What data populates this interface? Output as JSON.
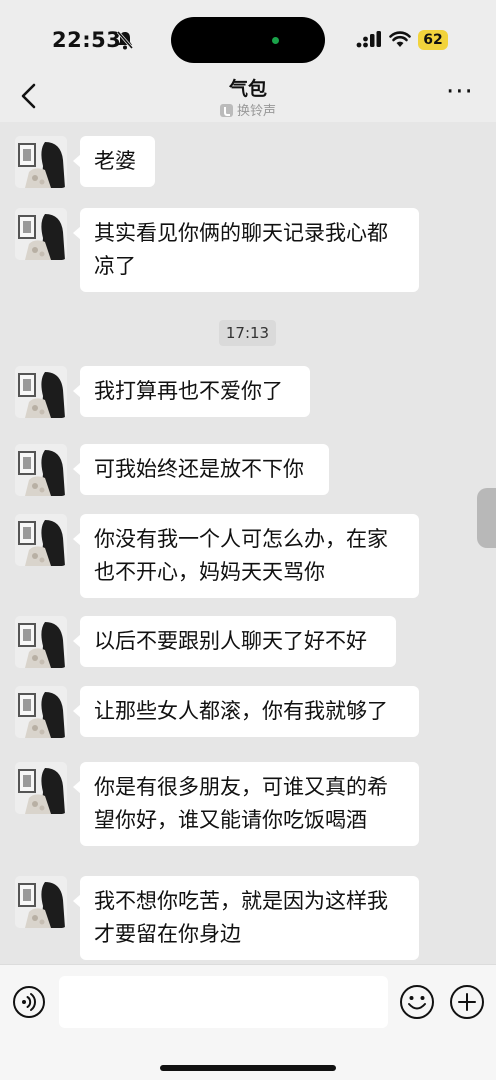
{
  "status_bar": {
    "time": "22:53",
    "battery": "62",
    "silent_icon": "bell-slash-icon",
    "signal_icon": "cellular-signal-icon",
    "wifi_icon": "wifi-icon",
    "battery_color": "#f2d33c"
  },
  "nav": {
    "title": "气包",
    "subtitle": "换铃声",
    "back_icon": "chevron-left-icon",
    "more_icon": "more-horizontal-icon"
  },
  "chat": {
    "timestamp": "17:13",
    "bubble_color": "#ffffff",
    "background_color": "#e6e6e6",
    "messages": [
      {
        "sender": "contact",
        "lines": [
          "老婆"
        ]
      },
      {
        "sender": "contact",
        "lines": [
          "其实看见你俩的聊天记录我心都",
          "凉了"
        ]
      },
      {
        "sender": "contact",
        "lines": [
          "我打算再也不爱你了"
        ]
      },
      {
        "sender": "contact",
        "lines": [
          "可我始终还是放不下你"
        ]
      },
      {
        "sender": "contact",
        "lines": [
          "你没有我一个人可怎么办，在家",
          "也不开心，妈妈天天骂你"
        ]
      },
      {
        "sender": "contact",
        "lines": [
          "以后不要跟别人聊天了好不好"
        ]
      },
      {
        "sender": "contact",
        "lines": [
          "让那些女人都滚，你有我就够了"
        ]
      },
      {
        "sender": "contact",
        "lines": [
          "你是有很多朋友，可谁又真的希",
          "望你好，谁又能请你吃饭喝酒"
        ]
      },
      {
        "sender": "contact",
        "lines": [
          "我不想你吃苦，就是因为这样我",
          "才要留在你身边"
        ]
      }
    ]
  },
  "input_bar": {
    "input_value": "",
    "voice_icon": "voice-input-icon",
    "emoji_icon": "emoji-icon",
    "plus_icon": "plus-circle-icon"
  }
}
